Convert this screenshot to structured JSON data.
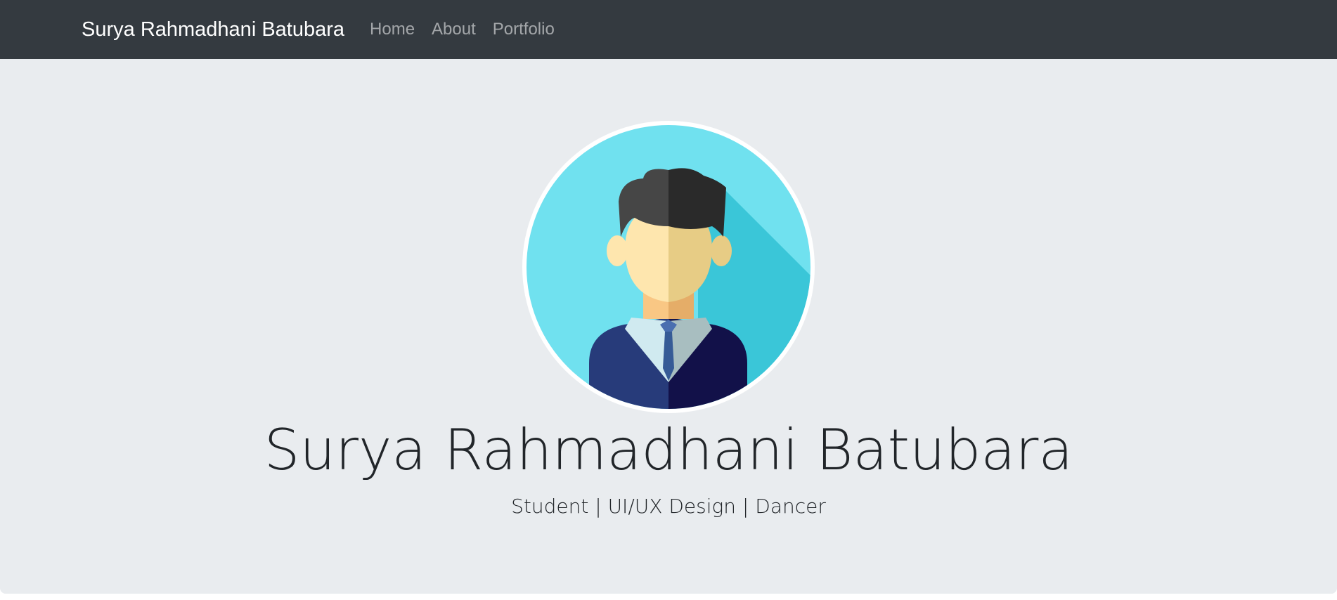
{
  "navbar": {
    "brand": "Surya Rahmadhani Batubara",
    "links": [
      {
        "label": "Home"
      },
      {
        "label": "About"
      },
      {
        "label": "Portfolio"
      }
    ],
    "background": "#343a40"
  },
  "hero": {
    "avatar_icon": "businessman-avatar-icon",
    "title": "Surya Rahmadhani Batubara",
    "lead": "Student | UI/UX Design | Dancer",
    "background": "#e9ecef"
  }
}
